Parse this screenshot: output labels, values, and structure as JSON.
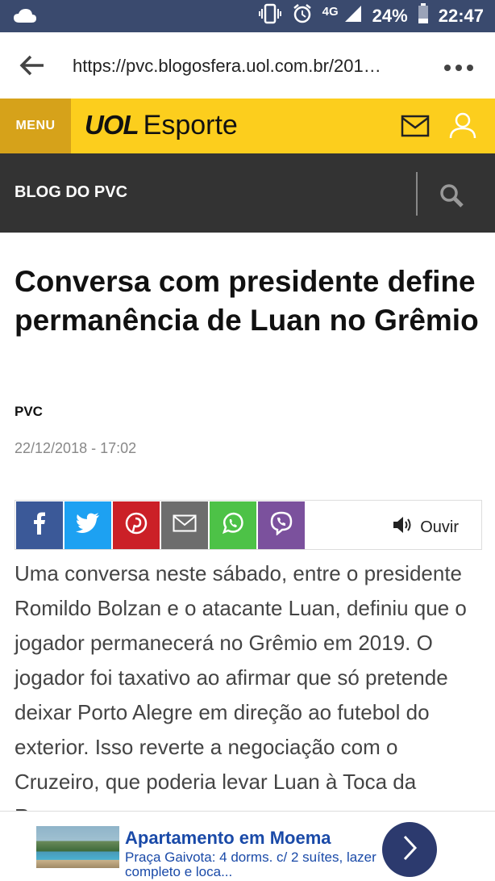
{
  "status_bar": {
    "network": "4G",
    "battery": "24%",
    "time": "22:47"
  },
  "browser": {
    "url": "https://pvc.blogosfera.uol.com.br/201…"
  },
  "header": {
    "menu_label": "MENU",
    "brand_bold": "UOL",
    "brand_light": "Esporte"
  },
  "blog": {
    "title": "BLOG DO PVC"
  },
  "article": {
    "headline": "Conversa com presidente define permanência de Luan no Grêmio",
    "author": "PVC",
    "date": "22/12/2018 - 17:02",
    "listen_label": "Ouvir",
    "body": "Uma conversa neste sábado, entre o presidente Romildo Bolzan e o atacante Luan, definiu que o jogador permanecerá no Grêmio em 2019. O jogador foi taxativo ao afirmar que só pretende deixar Porto Alegre em direção ao futebol do exterior. Isso reverte a negociação com o Cruzeiro, que poderia levar Luan à Toca da Raposa em"
  },
  "share": [
    {
      "network": "facebook",
      "color": "#3b5998"
    },
    {
      "network": "twitter",
      "color": "#1da1f2"
    },
    {
      "network": "pinterest",
      "color": "#cb2027"
    },
    {
      "network": "email",
      "color": "#6d6d6d"
    },
    {
      "network": "whatsapp",
      "color": "#4dc247"
    },
    {
      "network": "viber",
      "color": "#7b519d"
    }
  ],
  "ad": {
    "title": "Apartamento em Moema",
    "description": "Praça Gaivota: 4 dorms. c/ 2 suítes, lazer completo e loca..."
  },
  "colors": {
    "status_bar": "#3a4a6e",
    "uol_yellow": "#fcce1d",
    "menu_gold": "#d6a21a",
    "blog_bar": "#333333",
    "ad_link": "#1a4aa8"
  }
}
